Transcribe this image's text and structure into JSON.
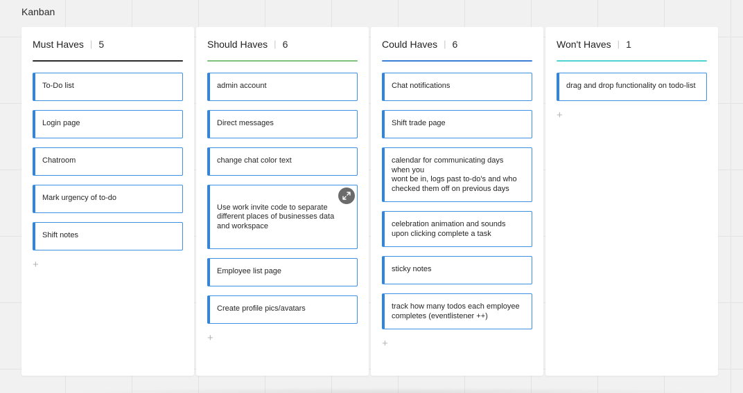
{
  "board": {
    "title": "Kanban"
  },
  "columns": [
    {
      "name": "Must Haves",
      "count": "5",
      "accent": "#2b2b2b",
      "cards": [
        "To-Do list",
        "Login page",
        "Chatroom",
        "Mark urgency of to-do",
        "Shift notes"
      ],
      "add_label": "+"
    },
    {
      "name": "Should Haves",
      "count": "6",
      "accent": "#7dc27a",
      "cards": [
        "admin account",
        "Direct messages",
        "change chat color text",
        "Use work invite code to separate different places of businesses data and workspace",
        "Employee list page",
        "Create profile pics/avatars"
      ],
      "add_label": "+"
    },
    {
      "name": "Could Haves",
      "count": "6",
      "accent": "#3a7fd6",
      "cards": [
        "Chat notifications",
        "Shift trade page",
        "calendar for communicating days when you\nwont be in, logs past to-do's and who checked them off on previous days",
        "celebration animation and sounds upon clicking complete a task",
        "sticky notes",
        "track how many todos each employee completes (eventlistener ++)"
      ],
      "add_label": "+"
    },
    {
      "name": "Won't Haves",
      "count": "1",
      "accent": "#4fd3d0",
      "cards": [
        "drag and drop functionality on todo-list"
      ],
      "add_label": "+"
    }
  ],
  "colors": {
    "card_border": "#2f86e0",
    "canvas": "#f1f1f1",
    "expand_button": "#6b6b6b"
  },
  "icons": {
    "expand": "expand-arrows-icon",
    "add": "plus-icon"
  }
}
